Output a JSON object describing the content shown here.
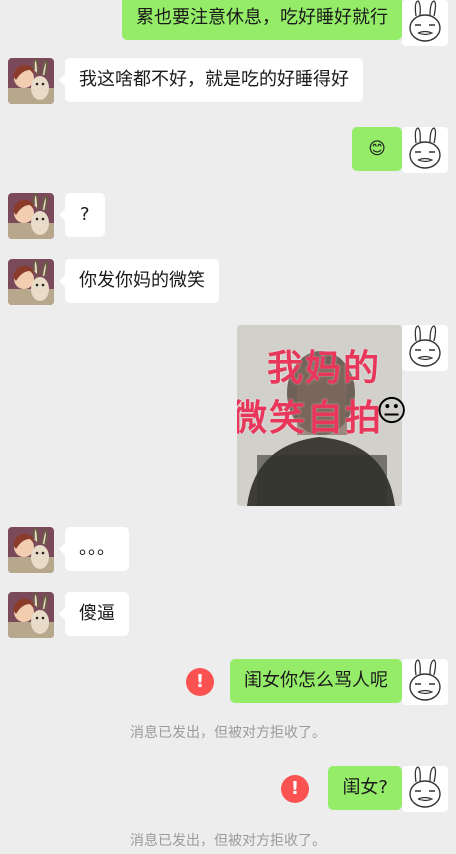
{
  "messages": [
    {
      "side": "right",
      "text": "累也要注意休息，吃好睡好就行"
    },
    {
      "side": "left",
      "text": "我这啥都不好，就是吃的好睡得好"
    },
    {
      "side": "right",
      "emoji": "😊"
    },
    {
      "side": "left",
      "text": "?"
    },
    {
      "side": "left",
      "text": "你发你妈的微笑"
    },
    {
      "side": "right",
      "image_line1": "我妈的",
      "image_line2": "微笑自拍",
      "image_emoji": "😐"
    },
    {
      "side": "left",
      "text": "。。。"
    },
    {
      "side": "left",
      "text": "傻逼"
    },
    {
      "side": "right",
      "text": "闺女你怎么骂人呢",
      "failed": true,
      "error_icon": "!",
      "notice": "消息已发出，但被对方拒收了。"
    },
    {
      "side": "right",
      "text": "闺女?",
      "failed": true,
      "error_icon": "!",
      "notice": "消息已发出，但被对方拒收了。"
    }
  ],
  "colors": {
    "background": "#ededed",
    "sent_bubble": "#95ec69",
    "received_bubble": "#ffffff",
    "error": "#fa5151",
    "notice_text": "#9b9b9b"
  }
}
